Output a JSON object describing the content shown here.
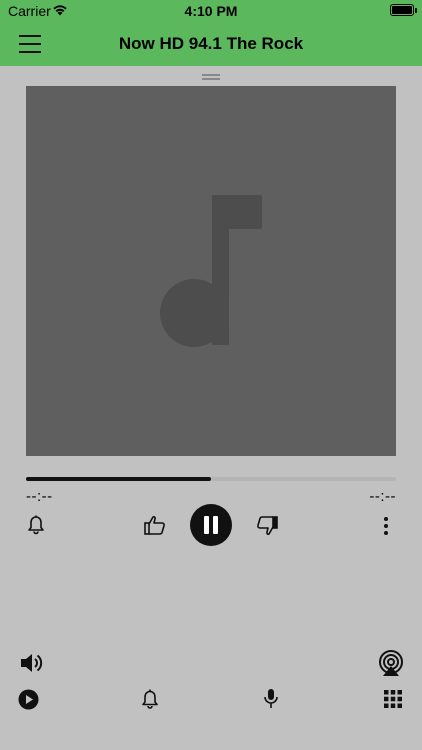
{
  "status_bar": {
    "carrier": "Carrier",
    "time": "4:10 PM",
    "icons": [
      "wifi-icon",
      "battery-icon"
    ]
  },
  "nav_bar": {
    "title": "Now HD 94.1 The Rock",
    "background_color": "#5cb85c",
    "menu_icon": "hamburger-menu-icon"
  },
  "player": {
    "artwork_placeholder_icon": "music-note-icon",
    "progress": 0.5,
    "elapsed_time": "--:--",
    "remaining_time": "--:--",
    "controls": {
      "alarm_icon": "bell-icon",
      "thumbs_up_icon": "thumbs-up-icon",
      "play_state": "playing",
      "pause_icon": "pause-icon",
      "thumbs_down_icon": "thumbs-down-icon",
      "more_icon": "more-vertical-icon"
    }
  },
  "secondary": {
    "volume_icon": "speaker-volume-icon",
    "airplay_icon": "airplay-icon"
  },
  "tab_bar": {
    "icons": [
      "play-circle-icon",
      "bell-icon",
      "microphone-icon",
      "grid-icon"
    ]
  },
  "colors": {
    "accent": "#5cb85c",
    "background": "#c1c1c1",
    "artwork_bg": "#5f5f5f",
    "artwork_icon": "#4d4d4d",
    "controls": "#111111"
  }
}
